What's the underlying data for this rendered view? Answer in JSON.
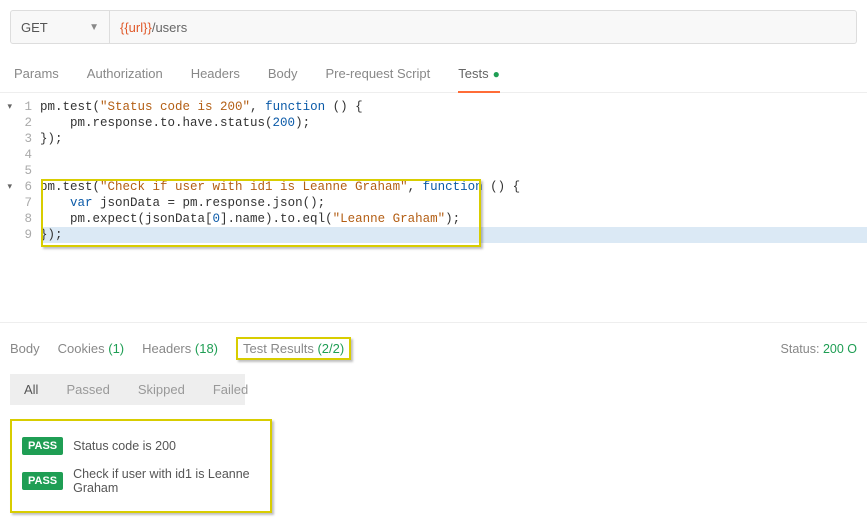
{
  "request": {
    "method": "GET",
    "url_var": "{{url}}",
    "url_rest": "/users"
  },
  "req_tabs": {
    "items": [
      "Params",
      "Authorization",
      "Headers",
      "Body",
      "Pre-request Script",
      "Tests"
    ],
    "active": "Tests",
    "has_dot": true
  },
  "code": {
    "lines": [
      {
        "n": 1,
        "fold": true,
        "seg": [
          "pm.test(",
          {
            "t": "str",
            "v": "\"Status code is 200\""
          },
          ", ",
          {
            "t": "kw",
            "v": "function"
          },
          " () {"
        ]
      },
      {
        "n": 2,
        "seg": [
          "    pm.response.to.have.status(",
          {
            "t": "num",
            "v": "200"
          },
          ");"
        ]
      },
      {
        "n": 3,
        "seg": [
          "});"
        ]
      },
      {
        "n": 4,
        "seg": [
          ""
        ]
      },
      {
        "n": 5,
        "seg": [
          ""
        ]
      },
      {
        "n": 6,
        "fold": true,
        "seg": [
          "pm.test(",
          {
            "t": "str",
            "v": "\"Check if user with id1 is Leanne Graham\""
          },
          ", ",
          {
            "t": "kw",
            "v": "function"
          },
          " () {"
        ]
      },
      {
        "n": 7,
        "seg": [
          "    ",
          {
            "t": "kw",
            "v": "var"
          },
          " jsonData = pm.response.json();"
        ]
      },
      {
        "n": 8,
        "seg": [
          "    pm.expect(jsonData[",
          {
            "t": "num",
            "v": "0"
          },
          "].name).to.eql(",
          {
            "t": "str",
            "v": "\"Leanne Graham\""
          },
          ");"
        ]
      },
      {
        "n": 9,
        "seg": [
          "});"
        ]
      }
    ]
  },
  "resp_tabs": {
    "body": "Body",
    "cookies_label": "Cookies",
    "cookies_count": "(1)",
    "headers_label": "Headers",
    "headers_count": "(18)",
    "testresults_label": "Test Results",
    "testresults_count": "(2/2)",
    "status_prefix": "Status:",
    "status_value": "200 O"
  },
  "filters": [
    "All",
    "Passed",
    "Skipped",
    "Failed"
  ],
  "filter_active": "All",
  "results": [
    {
      "badge": "PASS",
      "text": "Status code is 200"
    },
    {
      "badge": "PASS",
      "text": "Check if user with id1 is Leanne Graham"
    }
  ]
}
